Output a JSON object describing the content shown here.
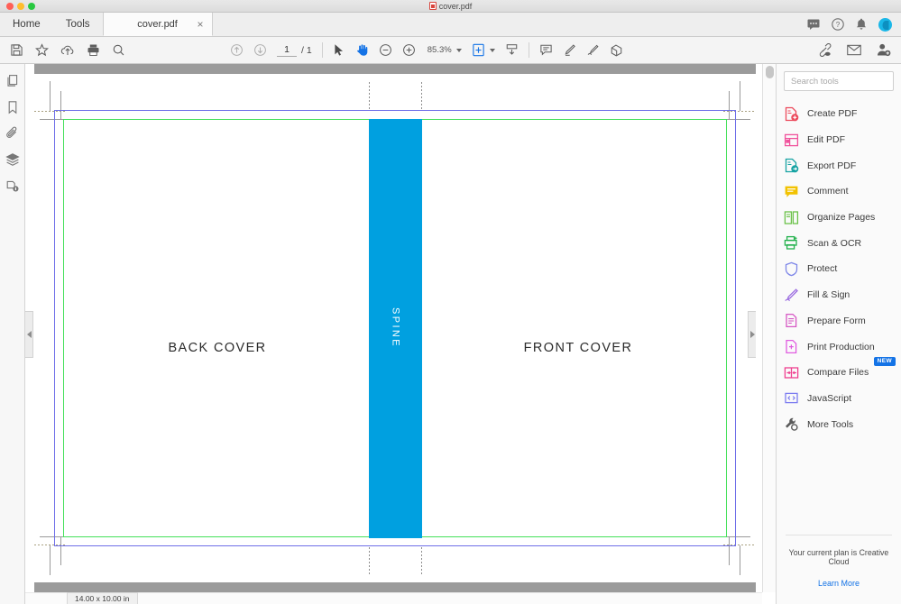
{
  "window": {
    "title": "cover.pdf",
    "title_icon": "pdf-file-icon"
  },
  "menubar": {
    "items": [
      {
        "label": "Home",
        "name": "menu-home"
      },
      {
        "label": "Tools",
        "name": "menu-tools"
      }
    ],
    "tab": {
      "label": "cover.pdf",
      "close": "×"
    },
    "right_icons": [
      {
        "name": "chat-icon"
      },
      {
        "name": "help-icon"
      },
      {
        "name": "bell-icon"
      },
      {
        "name": "avatar"
      }
    ]
  },
  "toolbar": {
    "left_icons": [
      "save-icon",
      "star-icon",
      "upload-cloud-icon",
      "print-icon",
      "search-icon"
    ],
    "nav": {
      "prev_page": "previous-page-icon",
      "next_page": "next-page-icon",
      "current_page": "1",
      "page_separator": "/ 1",
      "total_pages": "1"
    },
    "select_tool": "select-cursor-icon",
    "hand_tool": "hand-icon",
    "zoom_out": "zoom-out-icon",
    "zoom_in": "zoom-in-icon",
    "zoom_level": "85.3%",
    "page_fit": "page-fit-icon",
    "scroll_mode": "scroll-mode-icon",
    "annotate_icons": [
      "comment-icon",
      "highlight-icon",
      "draw-icon",
      "stamp-icon"
    ],
    "right_icons": [
      "share-link-icon",
      "email-icon",
      "add-person-icon"
    ]
  },
  "left_rail": {
    "items": [
      {
        "name": "page-thumbnails-icon"
      },
      {
        "name": "bookmarks-icon"
      },
      {
        "name": "attachments-icon"
      },
      {
        "name": "layers-icon"
      },
      {
        "name": "document-info-icon"
      }
    ]
  },
  "document": {
    "back_cover_label": "BACK COVER",
    "spine_label": "SPINE",
    "front_cover_label": "FRONT COVER",
    "page_size": "14.00 x 10.00 in",
    "colors": {
      "spine": "#00a0e0",
      "trim_box": "#6f6fe8",
      "safety_box": "#45e05a",
      "band": "#9b9b9b"
    }
  },
  "tools_panel": {
    "search": {
      "placeholder": "Search tools",
      "value": ""
    },
    "items": [
      {
        "label": "Create PDF",
        "icon": "create-pdf-icon",
        "color": "#ec4a5c",
        "badge": ""
      },
      {
        "label": "Edit PDF",
        "icon": "edit-pdf-icon",
        "color": "#f0529c",
        "badge": ""
      },
      {
        "label": "Export PDF",
        "icon": "export-pdf-icon",
        "color": "#17a3a3",
        "badge": ""
      },
      {
        "label": "Comment",
        "icon": "comment-tool-icon",
        "color": "#f2c200",
        "badge": ""
      },
      {
        "label": "Organize Pages",
        "icon": "organize-pages-icon",
        "color": "#6cc24a",
        "badge": ""
      },
      {
        "label": "Scan & OCR",
        "icon": "scan-ocr-icon",
        "color": "#22b14c",
        "badge": ""
      },
      {
        "label": "Protect",
        "icon": "protect-icon",
        "color": "#7d86e8",
        "badge": ""
      },
      {
        "label": "Fill & Sign",
        "icon": "fill-sign-icon",
        "color": "#9b6ce0",
        "badge": ""
      },
      {
        "label": "Prepare Form",
        "icon": "prepare-form-icon",
        "color": "#d657c4",
        "badge": ""
      },
      {
        "label": "Print Production",
        "icon": "print-production-icon",
        "color": "#e05ce0",
        "badge": ""
      },
      {
        "label": "Compare Files",
        "icon": "compare-files-icon",
        "color": "#ef3f8f",
        "badge": "NEW"
      },
      {
        "label": "JavaScript",
        "icon": "javascript-icon",
        "color": "#7d7df0",
        "badge": ""
      },
      {
        "label": "More Tools",
        "icon": "more-tools-icon",
        "color": "#5a5a5a",
        "badge": ""
      }
    ],
    "footer": {
      "plan_text": "Your current plan is Creative Cloud",
      "learn_more": "Learn More"
    }
  }
}
